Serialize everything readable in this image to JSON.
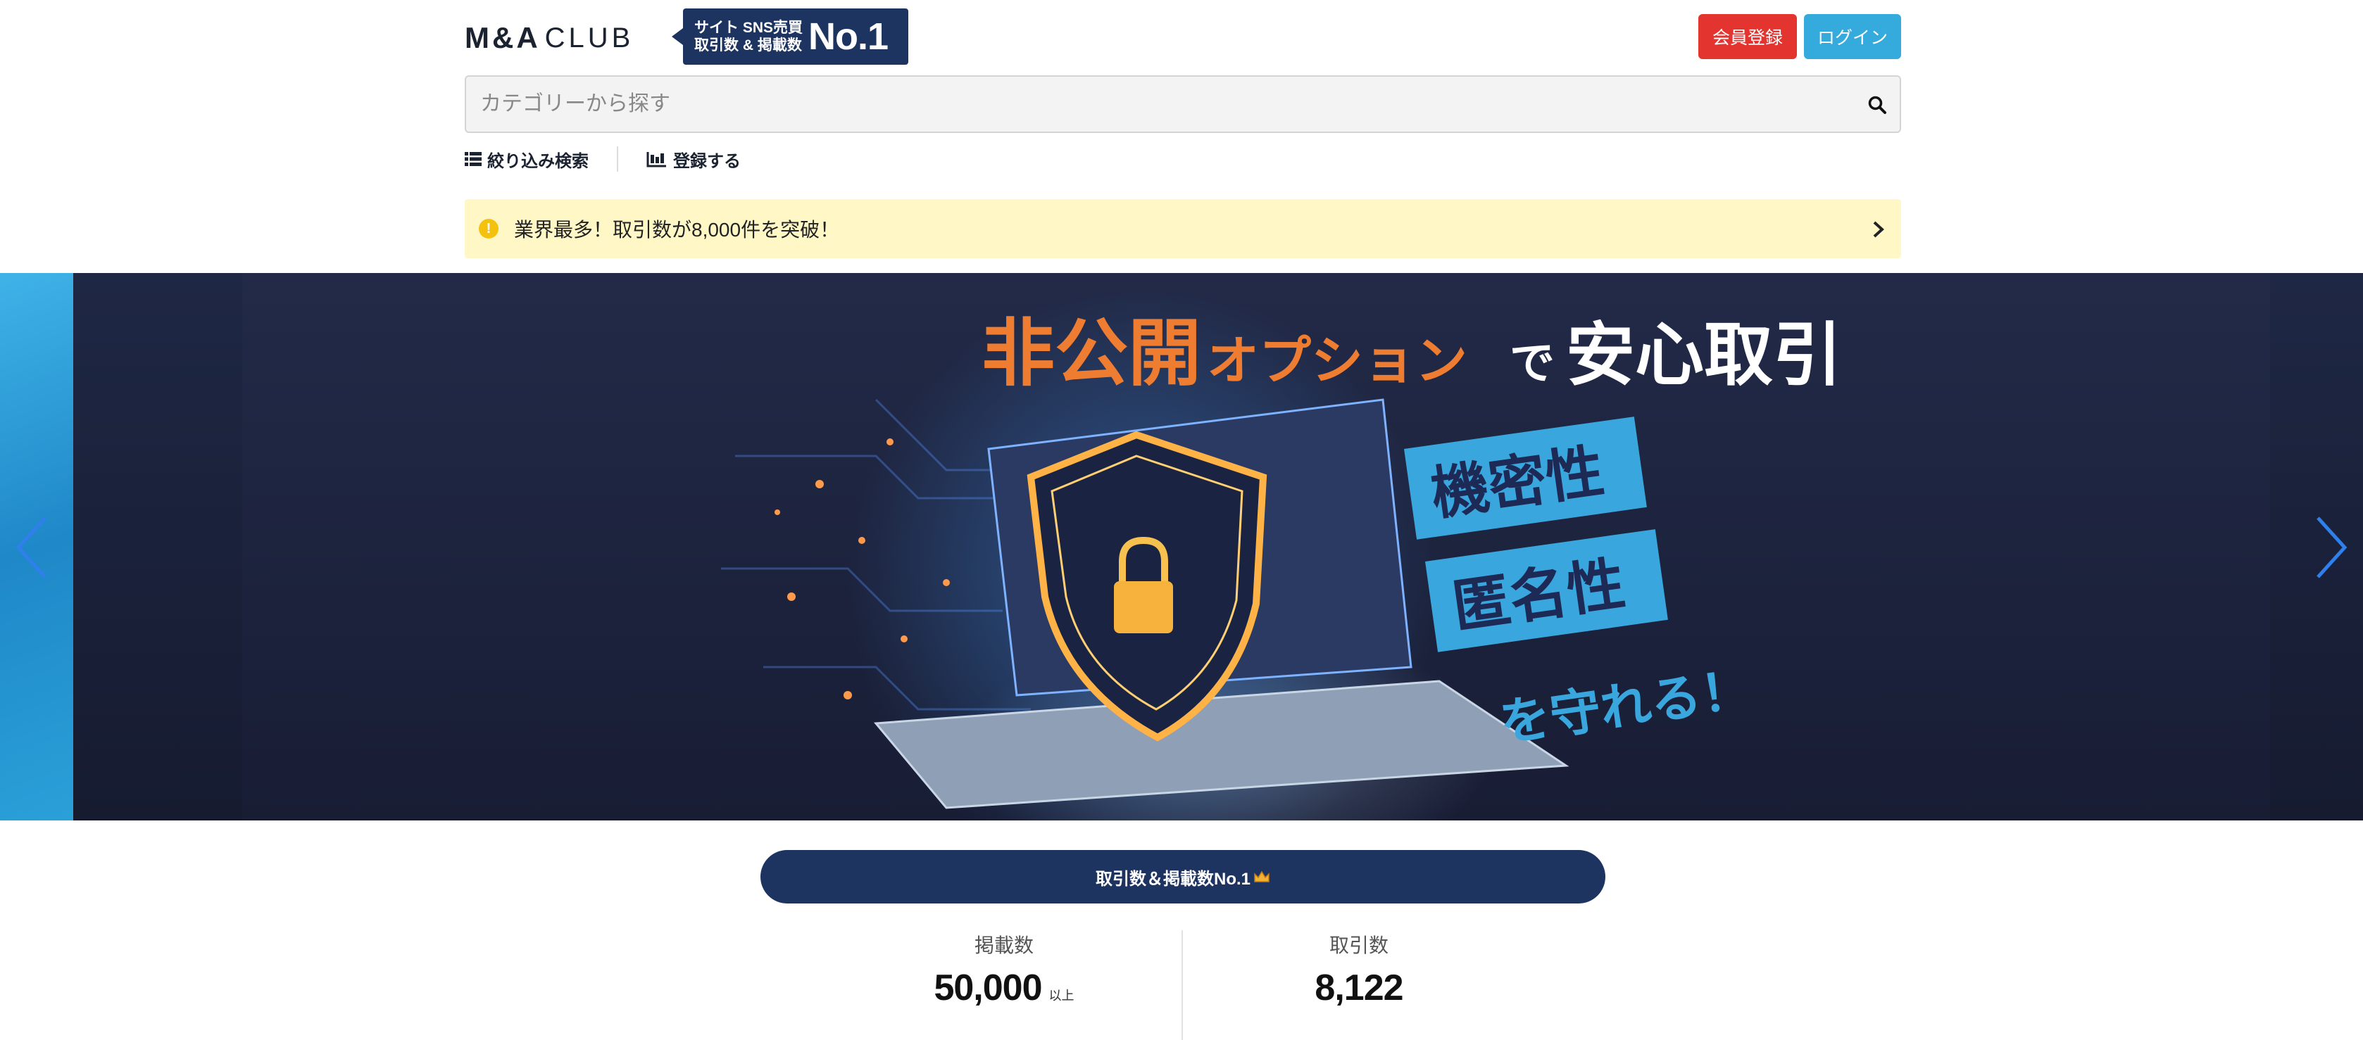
{
  "header": {
    "logo_ma": "M&A",
    "logo_club": "CLUB",
    "badge_line1": "サイト SNS売買",
    "badge_line2": "取引数 & 掲載数",
    "badge_no1": "No.1",
    "register_label": "会員登録",
    "login_label": "ログイン"
  },
  "search": {
    "placeholder": "カテゴリーから探す",
    "value": ""
  },
  "subnav": {
    "filter_label": "絞り込み検索",
    "register_listing_label": "登録する"
  },
  "notice": {
    "text": "業界最多！取引数が8,000件を突破！"
  },
  "hero": {
    "headline_part1": "非公開",
    "headline_part2": "オプション",
    "headline_part3": "で",
    "headline_part4": "安心取引",
    "tag1": "機密性",
    "tag2": "匿名性",
    "tagline": "を守れる！"
  },
  "stats": {
    "banner": "取引数＆掲載数No.1",
    "listings_label": "掲載数",
    "listings_value": "50,000",
    "listings_unit": "以上",
    "deals_label": "取引数",
    "deals_value": "8,122"
  },
  "colors": {
    "navy": "#1d3461",
    "register_red": "#e3342f",
    "login_blue": "#35aadc",
    "notice_yellow": "#fff8c6",
    "hero_orange": "#ee7d32",
    "hero_tag_blue": "#3aa6de"
  }
}
